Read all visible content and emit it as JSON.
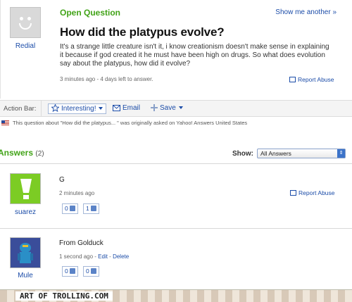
{
  "question": {
    "asker_name": "Redial",
    "header": "Open Question",
    "show_another": "Show me another »",
    "title": "How did the platypus evolve?",
    "body": "It's a strange little creature isn't it, i know creationism doesn't make sense in explaining it because if god created it he must have been high on drugs. So what does evolution say about the platypus, how did it evolve?",
    "meta": "3 minutes ago - 4 days left to answer.",
    "report_abuse": "Report Abuse"
  },
  "action_bar": {
    "label": "Action Bar:",
    "interesting": "Interesting!",
    "email": "Email",
    "save": "Save"
  },
  "origin_note": "This question about \"How did the platypus... \" was originally asked on Yahoo! Answers United States",
  "answers_header": {
    "title": "Answers",
    "count": "(2)",
    "show_label": "Show:",
    "filter_value": "All Answers"
  },
  "answers": [
    {
      "user": "suarez",
      "text": "G",
      "meta": "2 minutes ago",
      "report_abuse": "Report Abuse",
      "thumbs_up": "0",
      "thumbs_down": "1"
    },
    {
      "user": "Mule",
      "text": "From Golduck",
      "meta_time": "1 second ago - ",
      "edit": "Edit",
      "meta_sep": " - ",
      "delete": "Delete",
      "thumbs_up": "0",
      "thumbs_down": "0"
    }
  ],
  "footer_text": "ART OF TROLLING.COM",
  "colors": {
    "green_heading": "#41a317",
    "link_blue": "#1b4ca8",
    "suarez_avatar": "#6fbf1f",
    "mule_avatar": "#2d3f8c"
  },
  "icons": [
    "smiley-avatar-icon",
    "star-icon",
    "email-icon",
    "save-plus-icon",
    "flag-icon",
    "thumbs-up-icon",
    "thumbs-down-icon",
    "us-flag-icon",
    "dropdown-arrow-icon"
  ]
}
